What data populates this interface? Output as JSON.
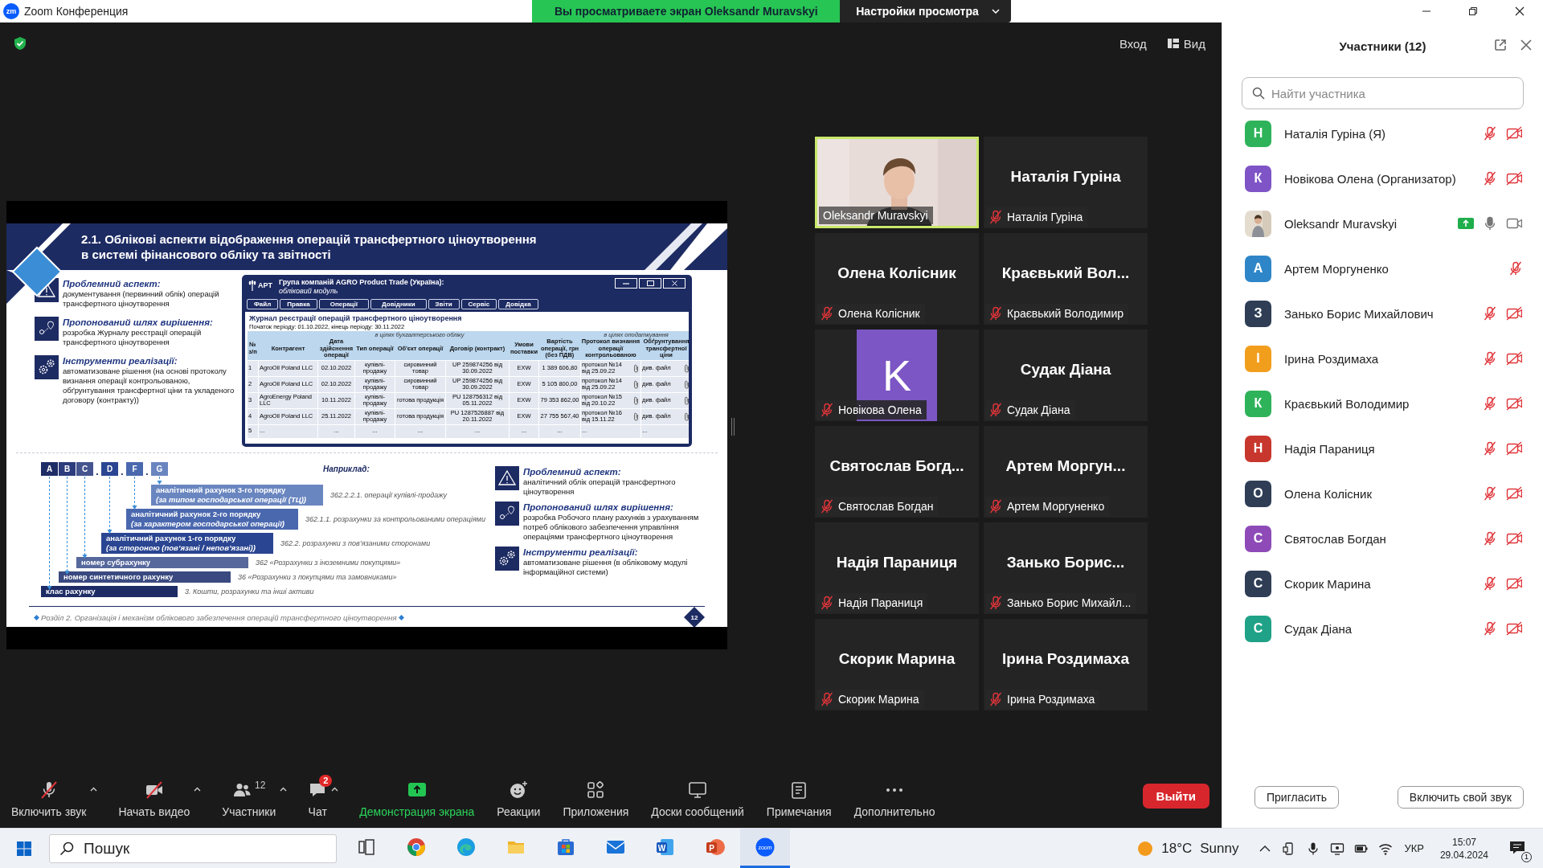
{
  "window": {
    "logo": "zm",
    "title": "Zoom Конференция"
  },
  "share_banner": {
    "text": "Вы просматриваете экран Oleksandr Muravskyi",
    "options": "Настройки просмотра"
  },
  "top_bar": {
    "sign_in": "Вход",
    "view": "Вид"
  },
  "slide": {
    "title": "2.1. Облікові аспекти відображення операцій трансфертного ціноутворення\nв системі фінансового обліку та звітності",
    "left_aspects": [
      {
        "kind": "warning",
        "heading": "Проблемний аспект:",
        "body": "документування (первинний облік) операцій трансфертного ціноутворення"
      },
      {
        "kind": "route",
        "heading": "Пропонований шлях вирішення:",
        "body": "розробка Журналу реєстрації операцій трансфертного ціноутворення"
      },
      {
        "kind": "gears",
        "heading": "Інструменти реалізації:",
        "body": "автоматизоване рішення (на основі протоколу визнання операції контрольованою, обґрунтування трансфертної ціни та укладеного договору (контракту))"
      }
    ],
    "app_window": {
      "logo": "АРТ",
      "title": "Група компаній AGRO Product Trade (Україна):",
      "subtitle": "обліковий модуль",
      "menu": [
        "Файл",
        "Правка",
        "Операції",
        "Довідники",
        "Звіти",
        "Сервіс",
        "Довідка"
      ],
      "journal_title": "Журнал реєстрації операцій трансфертного ціноутворення",
      "period": "Початок періоду: 01.10.2022, кінець періоду: 30.11.2022",
      "column_groups": [
        "в цілях бухгалтерського обліку",
        "в цілях оподаткування"
      ],
      "columns": [
        "№ з/п",
        "Контрагент",
        "Дата здійснення операції",
        "Тип операції",
        "Об'єкт операції",
        "Договір (контракт)",
        "Умови поставки",
        "Вартість операції, грн (без ПДВ)",
        "Протокол визнання операції контрольованою",
        "Обґрунтування трансфертної ціни"
      ],
      "rows": [
        {
          "attached": true,
          "cells": [
            "1",
            "AgroOil Poland LLC",
            "02.10.2022",
            "купівлі-продажу",
            "сировинний товар",
            "UP 259874256 від 30.09.2022",
            "EXW",
            "1 389 606,80",
            "протокол №14 від 25.09.22",
            "див. файл"
          ]
        },
        {
          "attached": true,
          "cells": [
            "2",
            "AgroOil Poland LLC",
            "02.10.2022",
            "купівлі-продажу",
            "сировинний товар",
            "UP 259874256 від 30.09.2022",
            "EXW",
            "5 105 800,00",
            "протокол №14 від 25.09.22",
            "див. файл"
          ]
        },
        {
          "attached": true,
          "cells": [
            "3",
            "AgroEnergy Poland LLC",
            "10.11.2022",
            "купівлі-продажу",
            "готова продукція",
            "PU 128756312 від 05.11.2022",
            "EXW",
            "79 353 862,00",
            "протокол №15 від 20.10.22",
            "див. файл"
          ]
        },
        {
          "attached": true,
          "cells": [
            "4",
            "AgroOil Poland LLC",
            "25.11.2022",
            "купівлі-продажу",
            "готова продукція",
            "PU 1287526887 від 20.11.2022",
            "EXW",
            "27 755 567,40",
            "протокол №16 від 15.11.22",
            "див. файл"
          ]
        },
        {
          "attached": false,
          "cells": [
            "5",
            "...",
            "...",
            "...",
            "...",
            "...",
            "...",
            "...",
            "...",
            "..."
          ]
        }
      ]
    },
    "code_letters": [
      {
        "kind": "letter",
        "text": "A",
        "color": "#1e2c66"
      },
      {
        "kind": "letter",
        "text": "B",
        "color": "#2c3c7c"
      },
      {
        "kind": "letter",
        "text": "C",
        "color": "#44548e"
      },
      {
        "kind": "dot",
        "text": "."
      },
      {
        "kind": "letter",
        "text": "D",
        "color": "#2a4591"
      },
      {
        "kind": "dot",
        "text": "."
      },
      {
        "kind": "letter",
        "text": "F",
        "color": "#4a68ae"
      },
      {
        "kind": "dot",
        "text": "."
      },
      {
        "kind": "letter",
        "text": "G",
        "color": "#6a86c0"
      }
    ],
    "example_label": "Наприклад:",
    "levels": [
      {
        "title": "аналітичний рахунок 3-го порядку",
        "subtitle": "(за типом господарської операції (ТЦ))",
        "example": "362.2.2.1. операції купівлі-продажу",
        "color": "#6a86c0"
      },
      {
        "title": "аналітичний рахунок 2-го порядку",
        "subtitle": "(за характером господарської операції)",
        "example": "362.1.1. розрахунки за контрольованими операціями",
        "color": "#4a68ae"
      },
      {
        "title": "аналітичний рахунок 1-го порядку",
        "subtitle": "(за стороною (пов’язані / непов’язані))",
        "example": "362.2. розрахунки з пов’язаними сторонами",
        "color": "#2a4591"
      },
      {
        "title": "номер субрахунку",
        "example": "362 «Розрахунки з іноземними покупцями»",
        "color": "#56689c"
      },
      {
        "title": "номер синтетичного рахунку",
        "example": "36 «Розрахунки з покупцями та замовниками»",
        "color": "#3a4a80"
      },
      {
        "title": "клас рахунку",
        "example": "3. Кошти, розрахунки та інші активи",
        "color": "#1e2c66"
      }
    ],
    "right_aspects": [
      {
        "kind": "warning",
        "heading": "Проблемний аспект:",
        "body": "аналітичний облік операцій трансфертного ціноутворення"
      },
      {
        "kind": "route",
        "heading": "Пропонований шлях вирішення:",
        "body": "розробка Робочого плану рахунків з урахуванням потреб облікового забезпечення управління операціями трансфертного ціноутворення"
      },
      {
        "kind": "gears",
        "heading": "Інструменти реалізації:",
        "body": "автоматизоване рішення (в обліковому модулі інформаційної системи)"
      }
    ],
    "footer": "Розділ 2. Організація і механізм облікового забезпечення операцій трансфертного ціноутворення",
    "page": "12"
  },
  "gallery": [
    {
      "kind": "video",
      "label": "Oleksandr Muravskyi",
      "muted": false,
      "speaking": true
    },
    {
      "kind": "name",
      "name": "Наталія Гуріна",
      "label": "Наталія Гуріна",
      "muted": true,
      "speaking": false
    },
    {
      "kind": "name",
      "name": "Олена Колісник",
      "label": "Олена Колісник",
      "muted": true,
      "speaking": false
    },
    {
      "kind": "name",
      "name": "Краєвький Вол...",
      "label": "Краєвький Володимир",
      "muted": true,
      "speaking": false
    },
    {
      "kind": "avatar",
      "initial": "K",
      "label": "Новікова Олена",
      "muted": true,
      "speaking": false
    },
    {
      "kind": "name",
      "name": "Судак Діана",
      "label": "Судак Діана",
      "muted": true,
      "speaking": false
    },
    {
      "kind": "name",
      "name": "Святослав Богд...",
      "label": "Святослав Богдан",
      "muted": true,
      "speaking": false
    },
    {
      "kind": "name",
      "name": "Артем Моргун...",
      "label": "Артем Моргуненко",
      "muted": true,
      "speaking": false
    },
    {
      "kind": "name",
      "name": "Надія Параниця",
      "label": "Надія Параниця",
      "muted": true,
      "speaking": false
    },
    {
      "kind": "name",
      "name": "Занько Борис...",
      "label": "Занько Борис Михайл...",
      "muted": true,
      "speaking": false
    },
    {
      "kind": "name",
      "name": "Скорик Марина",
      "label": "Скорик Марина",
      "muted": true,
      "speaking": false
    },
    {
      "kind": "name",
      "name": "Ірина Роздимаха",
      "label": "Ірина Роздимаха",
      "muted": true,
      "speaking": false
    }
  ],
  "participants": {
    "title": "Участники (12)",
    "search": {
      "placeholder": "Найти участника"
    },
    "items": [
      {
        "kind": "initial",
        "initial": "Н",
        "color": "#2eb35a",
        "name": "Наталія Гуріна (Я)",
        "muted": true,
        "video_off": true,
        "sharing": false
      },
      {
        "kind": "initial",
        "initial": "К",
        "color": "#7e54c6",
        "name": "Новікова Олена (Организатор)",
        "muted": true,
        "video_off": true,
        "sharing": false
      },
      {
        "name": "Oleksandr Muravskyi",
        "muted": false,
        "video_off": false,
        "sharing": true
      },
      {
        "kind": "initial",
        "initial": "А",
        "color": "#2e86c8",
        "name": "Артем Моргуненко",
        "muted": true,
        "sharing": false
      },
      {
        "kind": "initial",
        "initial": "З",
        "color": "#2f3e55",
        "name": "Занько Борис Михайлович",
        "muted": true,
        "video_off": true,
        "sharing": false
      },
      {
        "kind": "initial",
        "initial": "І",
        "color": "#f29e1d",
        "name": "Ірина Роздимаха",
        "muted": true,
        "video_off": true,
        "sharing": false
      },
      {
        "kind": "initial",
        "initial": "К",
        "color": "#2eb35a",
        "name": "Краєвький Володимир",
        "muted": true,
        "video_off": true,
        "sharing": false
      },
      {
        "kind": "initial",
        "initial": "Н",
        "color": "#c8372d",
        "name": "Надія Параниця",
        "muted": true,
        "video_off": true,
        "sharing": false
      },
      {
        "kind": "initial",
        "initial": "О",
        "color": "#2f3e55",
        "name": "Олена Колісник",
        "muted": true,
        "video_off": true,
        "sharing": false
      },
      {
        "kind": "initial",
        "initial": "С",
        "color": "#8e4bb8",
        "name": "Святослав Богдан",
        "muted": true,
        "video_off": true,
        "sharing": false
      },
      {
        "kind": "initial",
        "initial": "С",
        "color": "#2f3e55",
        "name": "Скорик Марина",
        "muted": true,
        "video_off": true,
        "sharing": false
      },
      {
        "kind": "initial",
        "initial": "С",
        "color": "#1fa287",
        "name": "Судак Діана",
        "muted": true,
        "video_off": true,
        "sharing": false
      }
    ],
    "buttons": [
      "Пригласить",
      "Включить свой звук"
    ]
  },
  "toolbar": {
    "items": [
      {
        "kind": "mic",
        "label": "Включить звук",
        "off": true,
        "caret": true
      },
      {
        "kind": "video",
        "label": "Начать видео",
        "off": true,
        "caret": true
      },
      {
        "kind": "participants",
        "label": "Участники",
        "count": "12",
        "off": false,
        "caret": true
      },
      {
        "kind": "chat",
        "label": "Чат",
        "badge": "2",
        "off": false,
        "caret": true
      },
      {
        "kind": "share",
        "label": "Демонстрация экрана",
        "off": false,
        "caret": false
      },
      {
        "kind": "reactions",
        "label": "Реакции",
        "off": false,
        "caret": false
      },
      {
        "kind": "apps",
        "label": "Приложения",
        "off": false,
        "caret": false
      },
      {
        "kind": "whiteboards",
        "label": "Доски сообщений",
        "off": false,
        "caret": false
      },
      {
        "kind": "notes",
        "label": "Примечания",
        "off": false,
        "caret": false
      },
      {
        "kind": "more",
        "label": "Дополнительно",
        "off": false,
        "caret": false
      }
    ],
    "leave": "Выйти"
  },
  "taskbar": {
    "search": {
      "placeholder": "Пошук"
    },
    "apps": [
      {
        "kind": "taskview",
        "selected": false
      },
      {
        "kind": "chrome",
        "selected": false
      },
      {
        "kind": "edge",
        "selected": false
      },
      {
        "kind": "folder",
        "selected": false
      },
      {
        "kind": "store",
        "selected": false
      },
      {
        "kind": "mail",
        "selected": false
      },
      {
        "kind": "word",
        "glyph": "W",
        "selected": false
      },
      {
        "kind": "powerpoint",
        "glyph": "P",
        "selected": false
      },
      {
        "kind": "zoom",
        "glyph": "zoom",
        "selected": true
      }
    ],
    "temperature": "18°C",
    "weather": "Sunny",
    "language": "УКР",
    "time": "15:07",
    "date": "29.04.2024",
    "notifications": "1"
  }
}
